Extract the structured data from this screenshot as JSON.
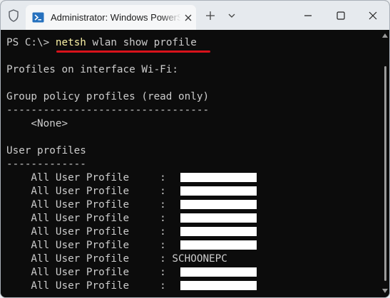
{
  "tab": {
    "title": "Administrator: Windows PowerShell",
    "icon": "powershell-icon"
  },
  "titlebar_icons": [
    "shield-icon",
    "close-icon",
    "plus-icon",
    "chevron-down-icon",
    "minimize-icon",
    "maximize-icon",
    "close-icon"
  ],
  "terminal": {
    "prompt": "PS C:\\> ",
    "command": "netsh",
    "command_args": " wlan show profile",
    "interface_line": "Profiles on interface Wi-Fi:",
    "group_header": "Group policy profiles (read only)",
    "group_sep": "---------------------------------",
    "none": "    <None>",
    "user_header": "User profiles",
    "user_sep": "-------------",
    "profiles": [
      {
        "label": "    All User Profile     : ",
        "value": "",
        "redacted": true
      },
      {
        "label": "    All User Profile     : ",
        "value": "",
        "redacted": true
      },
      {
        "label": "    All User Profile     : ",
        "value": "",
        "redacted": true
      },
      {
        "label": "    All User Profile     : ",
        "value": "",
        "redacted": true
      },
      {
        "label": "    All User Profile     : ",
        "value": "",
        "redacted": true
      },
      {
        "label": "    All User Profile     : ",
        "value": "",
        "redacted": true
      },
      {
        "label": "    All User Profile     : ",
        "value": "SCHOONEPC",
        "redacted": false
      },
      {
        "label": "    All User Profile     : ",
        "value": "",
        "redacted": true
      },
      {
        "label": "    All User Profile     : ",
        "value": "",
        "redacted": true
      }
    ]
  },
  "colors": {
    "command": "#f9f1a5",
    "text": "#cccccc",
    "background": "#0c0c0c",
    "underline": "#d8121b"
  }
}
